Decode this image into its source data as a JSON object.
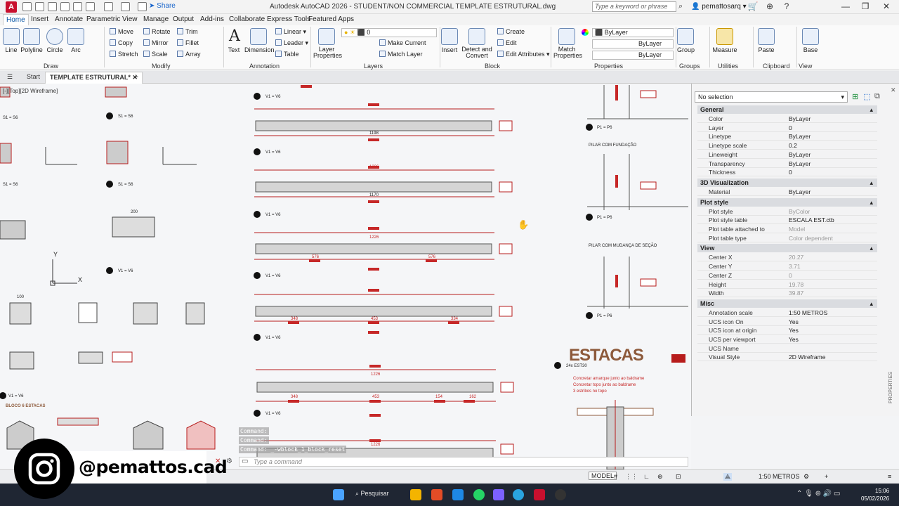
{
  "titlebar": {
    "app_letter": "A",
    "share_label": "Share",
    "title": "Autodesk AutoCAD 2026 - STUDENT/NON COMMERCIAL    TEMPLATE ESTRUTURAL.dwg",
    "search_placeholder": "Type a keyword or phrase",
    "user": "pemattosarq"
  },
  "menu_tabs": [
    "Home",
    "Insert",
    "Annotate",
    "Parametric",
    "View",
    "Manage",
    "Output",
    "Add-ins",
    "Collaborate",
    "Express Tools",
    "Featured Apps"
  ],
  "ribbon": {
    "draw": {
      "title": "Draw",
      "line": "Line",
      "polyline": "Polyline",
      "circle": "Circle",
      "arc": "Arc"
    },
    "modify": {
      "title": "Modify",
      "move": "Move",
      "rotate": "Rotate",
      "trim": "Trim",
      "copy": "Copy",
      "mirror": "Mirror",
      "fillet": "Fillet",
      "stretch": "Stretch",
      "scale": "Scale",
      "array": "Array"
    },
    "annotation": {
      "title": "Annotation",
      "text": "Text",
      "dimension": "Dimension",
      "linear": "Linear",
      "leader": "Leader",
      "table": "Table"
    },
    "layers": {
      "title": "Layers",
      "layer_properties": "Layer\nProperties",
      "layer_value": "0",
      "make_current": "Make Current",
      "match_layer": "Match Layer"
    },
    "block": {
      "title": "Block",
      "insert": "Insert",
      "detect_convert": "Detect and\nConvert",
      "create": "Create",
      "edit": "Edit",
      "edit_attributes": "Edit Attributes"
    },
    "properties": {
      "title": "Properties",
      "match_properties": "Match\nProperties",
      "bylayer_1": "ByLayer",
      "bylayer_2": "ByLayer",
      "bylayer_3": "ByLayer"
    },
    "groups": {
      "title": "Groups",
      "group": "Group"
    },
    "utilities": {
      "title": "Utilities",
      "measure": "Measure"
    },
    "clipboard": {
      "title": "Clipboard",
      "paste": "Paste"
    },
    "view": {
      "title": "View",
      "base": "Base"
    }
  },
  "doc_tabs": {
    "start": "Start",
    "active": "TEMPLATE ESTRUTURAL*"
  },
  "viewport_label": "[-][Top][2D Wireframe]",
  "properties_palette": {
    "selection": "No selection",
    "sidebar_label": "PROPERTIES",
    "sections": [
      {
        "name": "General",
        "rows": [
          [
            "Color",
            "ByLayer"
          ],
          [
            "Layer",
            "0"
          ],
          [
            "Linetype",
            "ByLayer"
          ],
          [
            "Linetype scale",
            "0.2"
          ],
          [
            "Lineweight",
            "ByLayer"
          ],
          [
            "Transparency",
            "ByLayer"
          ],
          [
            "Thickness",
            "0"
          ]
        ]
      },
      {
        "name": "3D Visualization",
        "rows": [
          [
            "Material",
            "ByLayer"
          ]
        ]
      },
      {
        "name": "Plot style",
        "rows": [
          [
            "Plot style",
            "ByColor"
          ],
          [
            "Plot style table",
            "ESCALA EST.ctb"
          ],
          [
            "Plot table attached to",
            "Model"
          ],
          [
            "Plot table type",
            "Color dependent"
          ]
        ]
      },
      {
        "name": "View",
        "rows": [
          [
            "Center X",
            "20.27"
          ],
          [
            "Center Y",
            "3.71"
          ],
          [
            "Center Z",
            "0"
          ],
          [
            "Height",
            "19.78"
          ],
          [
            "Width",
            "39.87"
          ]
        ]
      },
      {
        "name": "Misc",
        "rows": [
          [
            "Annotation scale",
            "1:50 METROS"
          ],
          [
            "UCS icon On",
            "Yes"
          ],
          [
            "UCS icon at origin",
            "Yes"
          ],
          [
            "UCS per viewport",
            "Yes"
          ],
          [
            "UCS Name",
            ""
          ],
          [
            "Visual Style",
            "2D Wireframe"
          ]
        ]
      }
    ]
  },
  "drawing": {
    "beam_label": "V1 = V6",
    "beam_label_count": "12",
    "slab_label": "S1 = S6",
    "pillar_label": "P1 = P6",
    "bloco_label": "BLOCO 6 ESTACAS",
    "estacas_title": "ESTACAS",
    "estacas_count": "24x EST30",
    "estacas_notes": [
      "Concretar amarque junto ao baldrame",
      "Concretar topo junto ao baldrame",
      "3 estribos no topo"
    ],
    "pilar_fund": "PILAR COM FUNDAÇÃO",
    "pilar_mud": "PILAR COM MUDANÇA DE SEÇÃO",
    "dims": [
      "1198",
      "1226",
      "1170",
      "1226",
      "576",
      "576",
      "348",
      "453",
      "334",
      "1226",
      "348",
      "453",
      "154",
      "162",
      "200",
      "100",
      "1226"
    ],
    "coord_y": "Y",
    "coord_x": "X"
  },
  "command": {
    "history": [
      "Command:",
      "Command:",
      "Command: _-wblock_1_block_reset"
    ],
    "placeholder": "Type a command"
  },
  "statusbar": {
    "model": "MODEL",
    "scale": "1:50 METROS"
  },
  "taskbar": {
    "search": "Pesquisar",
    "time": "15:06",
    "date": "05/02/2026"
  },
  "overlay": {
    "handle": "@pemattos.cad"
  }
}
